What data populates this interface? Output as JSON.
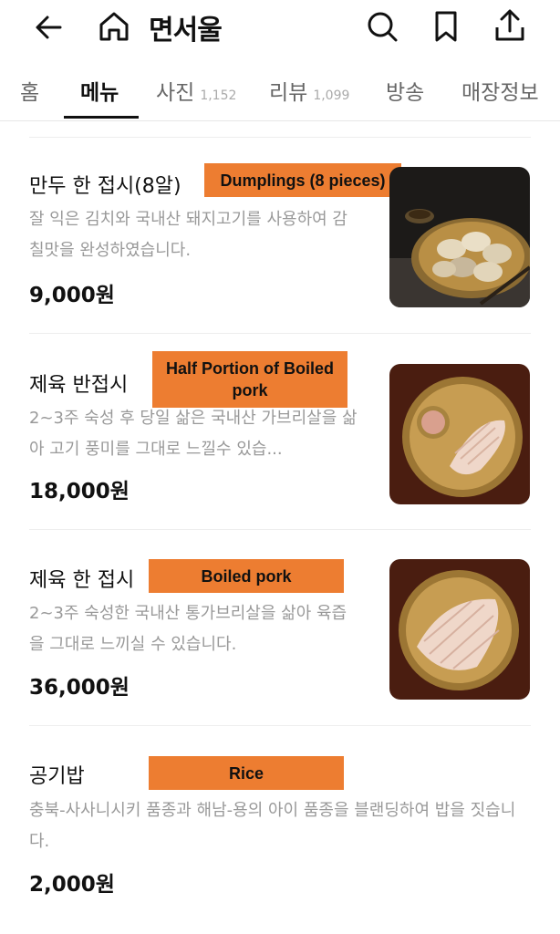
{
  "header": {
    "title": "면서울",
    "back_icon": "arrow-left-icon",
    "home_icon": "home-icon",
    "search_icon": "search-icon",
    "bookmark_icon": "bookmark-icon",
    "share_icon": "share-icon"
  },
  "tabs": [
    {
      "label": "홈",
      "count": ""
    },
    {
      "label": "메뉴",
      "count": "",
      "active": true
    },
    {
      "label": "사진",
      "count": "1,152"
    },
    {
      "label": "리뷰",
      "count": "1,099"
    },
    {
      "label": "방송",
      "count": ""
    },
    {
      "label": "매장정보",
      "count": ""
    }
  ],
  "menu": [
    {
      "name": "만두 한 접시(8알)",
      "tag": "Dumplings (8 pieces)",
      "description": "잘 익은 김치와 국내산 돼지고기를 사용하여 감칠맛을 완성하였습니다.",
      "price": "9,000원"
    },
    {
      "name": "제육 반접시",
      "tag": "Half Portion of Boiled pork",
      "description": "2~3주 숙성 후 당일 삶은 국내산 가브리살을 삶아 고기 풍미를 그대로 느낄수 있습...",
      "price": "18,000원"
    },
    {
      "name": "제육 한 접시",
      "tag": "Boiled pork",
      "description": "2~3주 숙성한 국내산 통가브리살을 삶아 육즙을 그대로 느끼실 수 있습니다.",
      "price": "36,000원"
    },
    {
      "name": "공기밥",
      "tag": "Rice",
      "description": "충북-사사니시키 품종과 해남-용의 아이 품종을 블랜딩하여 밥을 짓습니다.",
      "price": "2,000원"
    }
  ],
  "colors": {
    "tag_bg": "#ed7d31",
    "text_main": "#111111",
    "text_desc": "#999999"
  }
}
